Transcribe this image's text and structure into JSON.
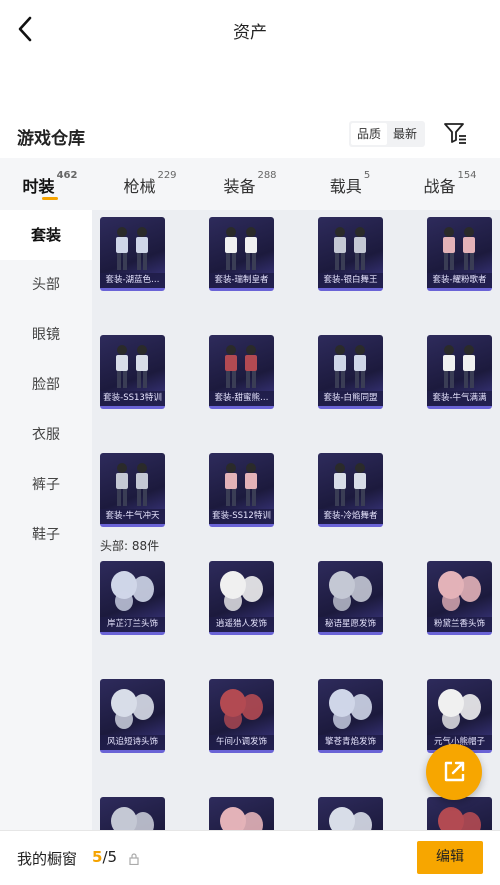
{
  "header": {
    "title": "资产"
  },
  "section": {
    "title": "游戏仓库",
    "sort_options": [
      "品质",
      "最新"
    ],
    "sort_active": 0
  },
  "tabs": [
    {
      "label": "时装",
      "count": "462"
    },
    {
      "label": "枪械",
      "count": "229"
    },
    {
      "label": "装备",
      "count": "288"
    },
    {
      "label": "载具",
      "count": "5"
    },
    {
      "label": "战备",
      "count": "154"
    }
  ],
  "tab_active": 0,
  "sidebar": {
    "items": [
      "套装",
      "头部",
      "眼镜",
      "脸部",
      "衣服",
      "裤子",
      "鞋子"
    ],
    "active": 0
  },
  "groups": {
    "suits": {
      "items": [
        "套装-湖蓝色…",
        "套装-瑞制皇者",
        "套装-银白舞王",
        "套装-耀粉歌者",
        "套装-SS13特训",
        "套装-甜蜜熊…",
        "套装-白熊同盟",
        "套装-牛气满满",
        "套装-牛气冲天",
        "套装-SS12特训",
        "套装-冷焰舞者"
      ]
    },
    "head": {
      "label": "头部: 88件",
      "items": [
        "岸芷汀兰头饰",
        "逍遥猎人发饰",
        "秘语星愿发饰",
        "粉黛兰香头饰",
        "风追短诗头饰",
        "午间小调发饰",
        "擎苍青焰发饰",
        "元气小熊帽子",
        "",
        "",
        "",
        ""
      ]
    }
  },
  "bottom": {
    "label": "我的橱窗",
    "current": "5",
    "total": "/5",
    "edit_label": "编辑"
  },
  "colors": {
    "accent": "#f7a600",
    "card_bg": "#2e2b5c",
    "card_border": "#6a63d6"
  },
  "icons": {
    "back": "chevron-left-icon",
    "filter": "filter-icon",
    "share": "share-external-icon",
    "lock": "lock-icon"
  }
}
